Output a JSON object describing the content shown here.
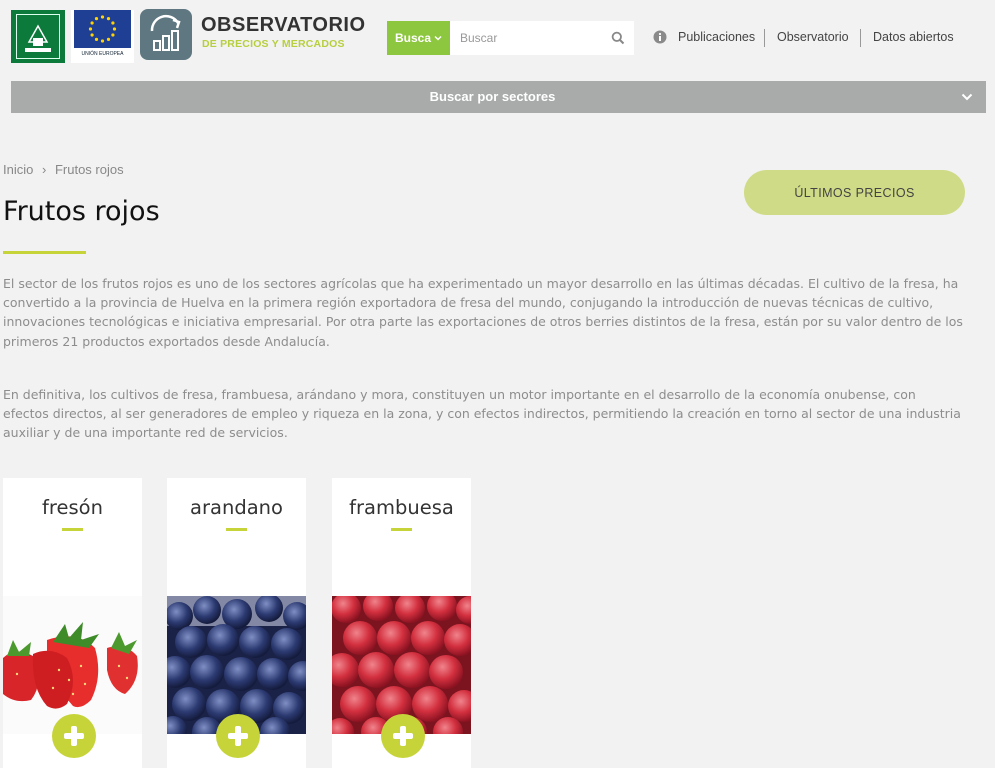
{
  "header": {
    "logo_junta_text": "JUNTA DE ANDALUCIA",
    "logo_ue_text": "UNIÓN EUROPEA",
    "observatorio_title": "OBSERVATORIO",
    "observatorio_subtitle": "DE PRECIOS Y MERCADOS",
    "busca_label": "Busca",
    "search_placeholder": "Buscar",
    "nav": [
      "Publicaciones",
      "Observatorio",
      "Datos abiertos"
    ]
  },
  "sectors_bar": {
    "label": "Buscar por sectores"
  },
  "breadcrumb": {
    "home": "Inicio",
    "separator": "›",
    "current": "Frutos rojos"
  },
  "page": {
    "title": "Frutos rojos",
    "precios_button": "ÚLTIMOS PRECIOS",
    "paragraphs": [
      "El sector de los frutos rojos es uno de los sectores agrícolas que ha experimentado un mayor desarrollo en las últimas décadas. El cultivo de la fresa, ha convertido a la provincia de Huelva en la primera región exportadora de fresa del mundo, conjugando la introducción de nuevas técnicas de cultivo, innovaciones tecnológicas e iniciativa empresarial. Por otra parte las exportaciones de otros berries distintos de la fresa, están por su valor dentro de los primeros 21 productos exportados desde Andalucía.",
      "En definitiva, los cultivos de fresa, frambuesa, arándano y mora, constituyen un motor importante en el desarrollo de la economía onubense, con efectos directos, al ser generadores de empleo y riqueza en la zona, y con efectos indirectos, permitiendo la creación en torno al sector de una industria auxiliar y de una importante red de servicios."
    ]
  },
  "cards": [
    {
      "name": "fresón",
      "photo": "strawberries"
    },
    {
      "name": "arandano",
      "photo": "blueberries"
    },
    {
      "name": "frambuesa",
      "photo": "raspberries"
    }
  ],
  "colors": {
    "accent": "#c6d43a",
    "busca_green": "#8dc63f",
    "sectors_bar": "#a9abab",
    "precios_button": "#cfdb86"
  }
}
